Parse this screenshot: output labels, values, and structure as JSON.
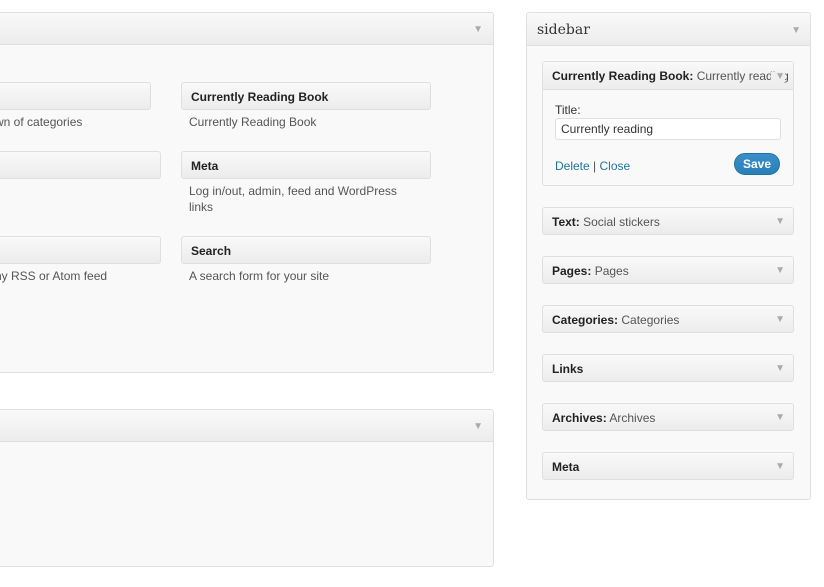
{
  "available": {
    "widgets": [
      {
        "title": "",
        "desc": "wn of categories"
      },
      {
        "title": "Currently Reading Book",
        "desc": "Currently Reading Book"
      },
      {
        "title": "",
        "desc": ""
      },
      {
        "title": "Meta",
        "desc": "Log in/out, admin, feed and WordPress links"
      },
      {
        "title": "",
        "desc": "ny RSS or Atom feed"
      },
      {
        "title": "Search",
        "desc": "A search form for your site"
      }
    ]
  },
  "sidebar": {
    "title": "sidebar",
    "open_widget": {
      "name": "Currently Reading Book:",
      "instance": "Currently reading",
      "title_label": "Title:",
      "title_value": "Currently reading",
      "delete_label": "Delete",
      "separator": "|",
      "close_label": "Close",
      "save_label": "Save"
    },
    "widgets": [
      {
        "name": "Text:",
        "instance": "Social stickers"
      },
      {
        "name": "Pages:",
        "instance": "Pages"
      },
      {
        "name": "Categories:",
        "instance": "Categories"
      },
      {
        "name": "Links",
        "instance": ""
      },
      {
        "name": "Archives:",
        "instance": "Archives"
      },
      {
        "name": "Meta",
        "instance": ""
      }
    ]
  },
  "colors": {
    "link": "#21759b",
    "save_button": "#2a7fb8"
  },
  "icons": {
    "collapse": "triangle-down-icon"
  }
}
